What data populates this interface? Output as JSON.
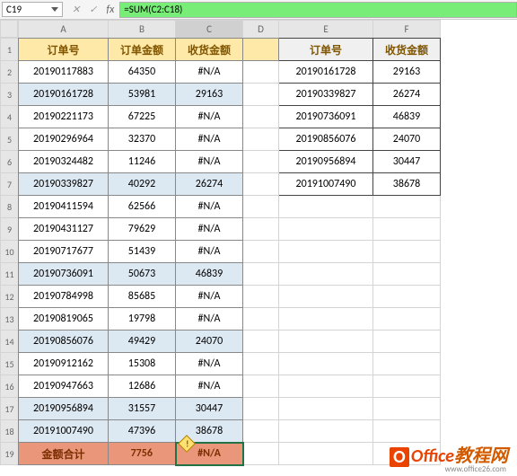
{
  "namebox": "C19",
  "formula": "=SUM(C2:C18)",
  "fx_label": "fx",
  "cols": [
    "A",
    "B",
    "C",
    "D",
    "E",
    "F"
  ],
  "hdr": {
    "a": "订单号",
    "b": "订单金额",
    "c": "收货金额"
  },
  "rows": [
    {
      "a": "20190117883",
      "b": "64350",
      "c": "#N/A"
    },
    {
      "a": "20190161728",
      "b": "53981",
      "c": "29163"
    },
    {
      "a": "20190221173",
      "b": "67225",
      "c": "#N/A"
    },
    {
      "a": "20190296964",
      "b": "32370",
      "c": "#N/A"
    },
    {
      "a": "20190324482",
      "b": "11246",
      "c": "#N/A"
    },
    {
      "a": "20190339827",
      "b": "40292",
      "c": "26274"
    },
    {
      "a": "20190411594",
      "b": "62566",
      "c": "#N/A"
    },
    {
      "a": "20190431127",
      "b": "79629",
      "c": "#N/A"
    },
    {
      "a": "20190717677",
      "b": "51439",
      "c": "#N/A"
    },
    {
      "a": "20190736091",
      "b": "50673",
      "c": "46839"
    },
    {
      "a": "20190784998",
      "b": "85685",
      "c": "#N/A"
    },
    {
      "a": "20190819065",
      "b": "19798",
      "c": "#N/A"
    },
    {
      "a": "20190856076",
      "b": "49429",
      "c": "24070"
    },
    {
      "a": "20190912162",
      "b": "15308",
      "c": "#N/A"
    },
    {
      "a": "20190947663",
      "b": "12686",
      "c": "#N/A"
    },
    {
      "a": "20190956894",
      "b": "31557",
      "c": "30447"
    },
    {
      "a": "20191007490",
      "b": "47396",
      "c": "38678"
    }
  ],
  "total": {
    "a": "金额合计",
    "b": "7756",
    "c": "#N/A"
  },
  "lookup_hdr": {
    "e": "订单号",
    "f": "收货金额"
  },
  "lookup": [
    {
      "e": "20190161728",
      "f": "29163"
    },
    {
      "e": "20190339827",
      "f": "26274"
    },
    {
      "e": "20190736091",
      "f": "46839"
    },
    {
      "e": "20190856076",
      "f": "24070"
    },
    {
      "e": "20190956894",
      "f": "30447"
    },
    {
      "e": "20191007490",
      "f": "38678"
    }
  ],
  "wm": {
    "brand": "Office",
    "suffix": "教程网",
    "url": "www.office26.com",
    "logo": "O"
  }
}
